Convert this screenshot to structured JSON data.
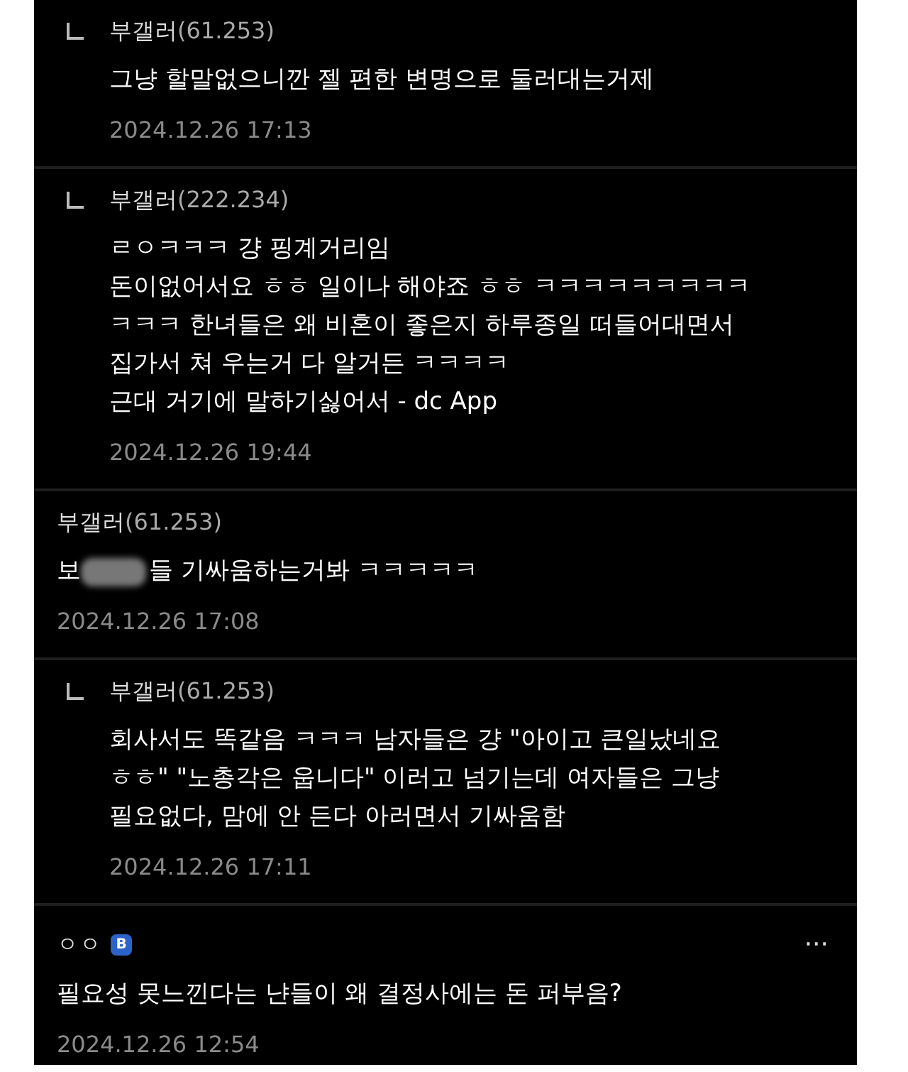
{
  "comments": [
    {
      "kind": "reply",
      "author": "부갤러",
      "ip": "(61.253)",
      "lines": [
        "그냥 할말없으니깐 젤 편한 변명으로 둘러대는거제"
      ],
      "date": "2024.12.26 17:13"
    },
    {
      "kind": "reply",
      "author": "부갤러",
      "ip": "(222.234)",
      "lines": [
        "ㄹㅇㅋㅋㅋ 걍 핑계거리임",
        "돈이없어서요 ㅎㅎ 일이나 해야죠 ㅎㅎ ㅋㅋㅋㅋㅋㅋㅋㅋㅋ",
        "ㅋㅋㅋ 한녀들은 왜 비혼이 좋은지 하루종일 떠들어대면서",
        "집가서 쳐 우는거 다 알거든 ㅋㅋㅋㅋ",
        "근대 거기에 말하기싫어서 - dc App"
      ],
      "date": "2024.12.26 19:44"
    },
    {
      "kind": "comment",
      "author": "부갤러",
      "ip": "(61.253)",
      "text_before": "보",
      "censored": true,
      "lines": [
        "들 기싸움하는거봐 ㅋㅋㅋㅋㅋ"
      ],
      "date": "2024.12.26 17:08"
    },
    {
      "kind": "reply",
      "author": "부갤러",
      "ip": "(61.253)",
      "lines": [
        "회사서도 똑같음 ㅋㅋㅋ 남자들은 걍 \"아이고 큰일났네요",
        "ㅎㅎ\" \"노총각은 웁니다\" 이러고 넘기는데 여자들은 그냥",
        "필요없다, 맘에 안 든다 아러면서 기싸움함"
      ],
      "date": "2024.12.26 17:11"
    },
    {
      "kind": "post",
      "author": "ㅇㅇ",
      "badge": "B",
      "more": "···",
      "lines": [
        "필요성 못느낀다는 냔들이 왜 결정사에는 돈 퍼부음?"
      ],
      "date": "2024.12.26 12:54"
    }
  ]
}
